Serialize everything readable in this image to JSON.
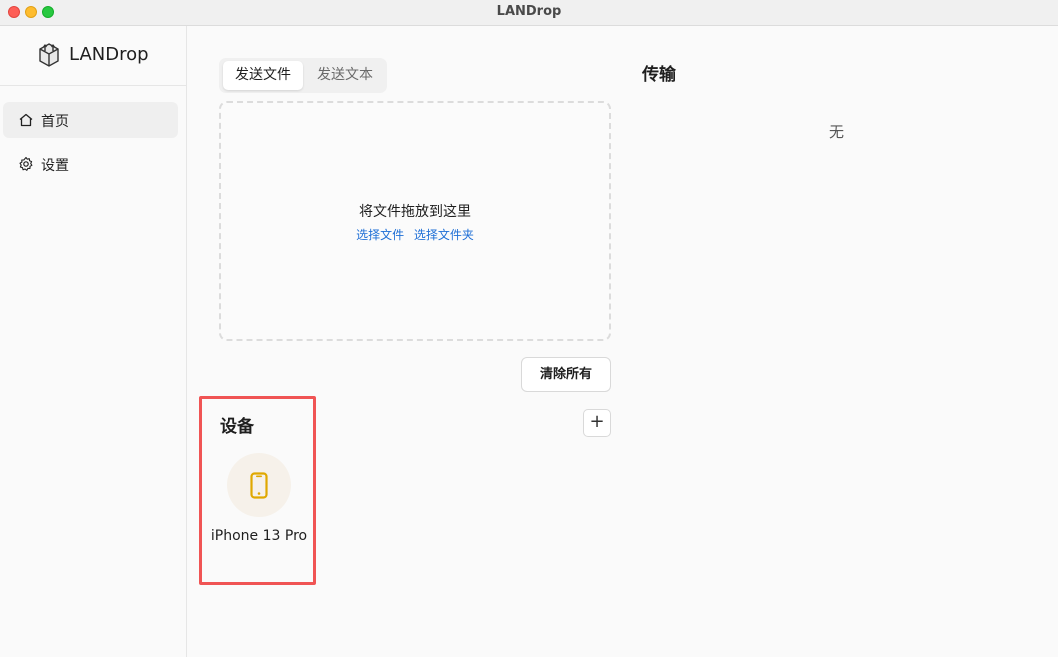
{
  "window": {
    "title": "LANDrop"
  },
  "sidebar": {
    "brand": "LANDrop",
    "items": [
      {
        "label": "首页",
        "icon": "home-icon",
        "active": true
      },
      {
        "label": "设置",
        "icon": "gear-icon",
        "active": false
      }
    ]
  },
  "send": {
    "tabs": [
      {
        "label": "发送文件",
        "active": true
      },
      {
        "label": "发送文本",
        "active": false
      }
    ],
    "drop_title": "将文件拖放到这里",
    "choose_file": "选择文件",
    "choose_folder": "选择文件夹",
    "clear_all": "清除所有"
  },
  "devices": {
    "title": "设备",
    "add_label": "+",
    "items": [
      {
        "name": "iPhone 13 Pro",
        "icon": "phone-icon"
      }
    ]
  },
  "transfer": {
    "title": "传输",
    "empty": "无"
  },
  "colors": {
    "accent_link": "#1f6fd6",
    "device_icon": "#e0a800",
    "highlight": "#f05454"
  }
}
